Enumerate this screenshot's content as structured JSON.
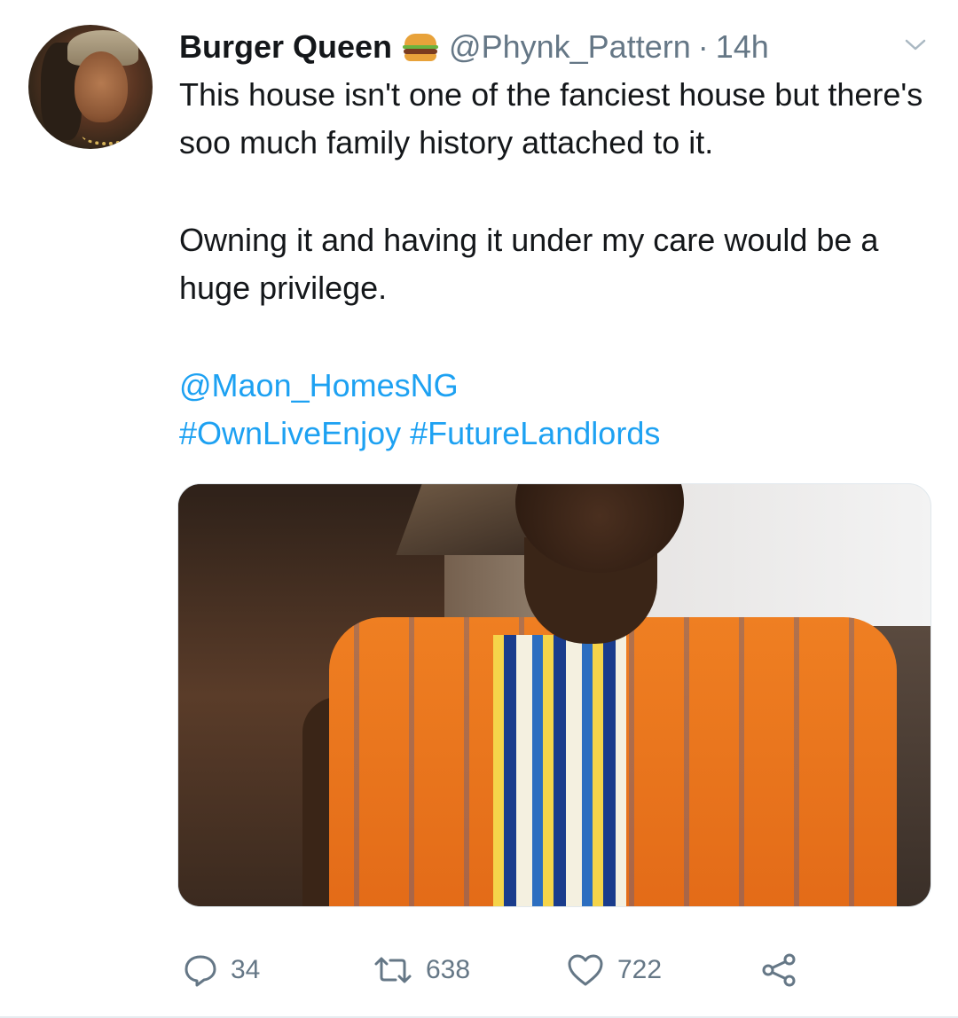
{
  "tweet": {
    "author": {
      "name": "Burger Queen",
      "emoji_icon": "burger-icon",
      "handle": "@Phynk_Pattern",
      "separator": "·",
      "time": "14h"
    },
    "text": {
      "line1": "This house isn't one of the fanciest house but there's soo much family history attached to it.",
      "line2": "Owning it and having it under my care would be a huge privilege.",
      "mention": "@Maon_HomesNG",
      "hashtag1": "#OwnLiveEnjoy",
      "hashtag2": "#FutureLandlords"
    },
    "actions": {
      "replies": "34",
      "retweets": "638",
      "likes": "722"
    },
    "colors": {
      "link": "#1da1f2",
      "secondary": "#657786",
      "text": "#14171a"
    }
  }
}
